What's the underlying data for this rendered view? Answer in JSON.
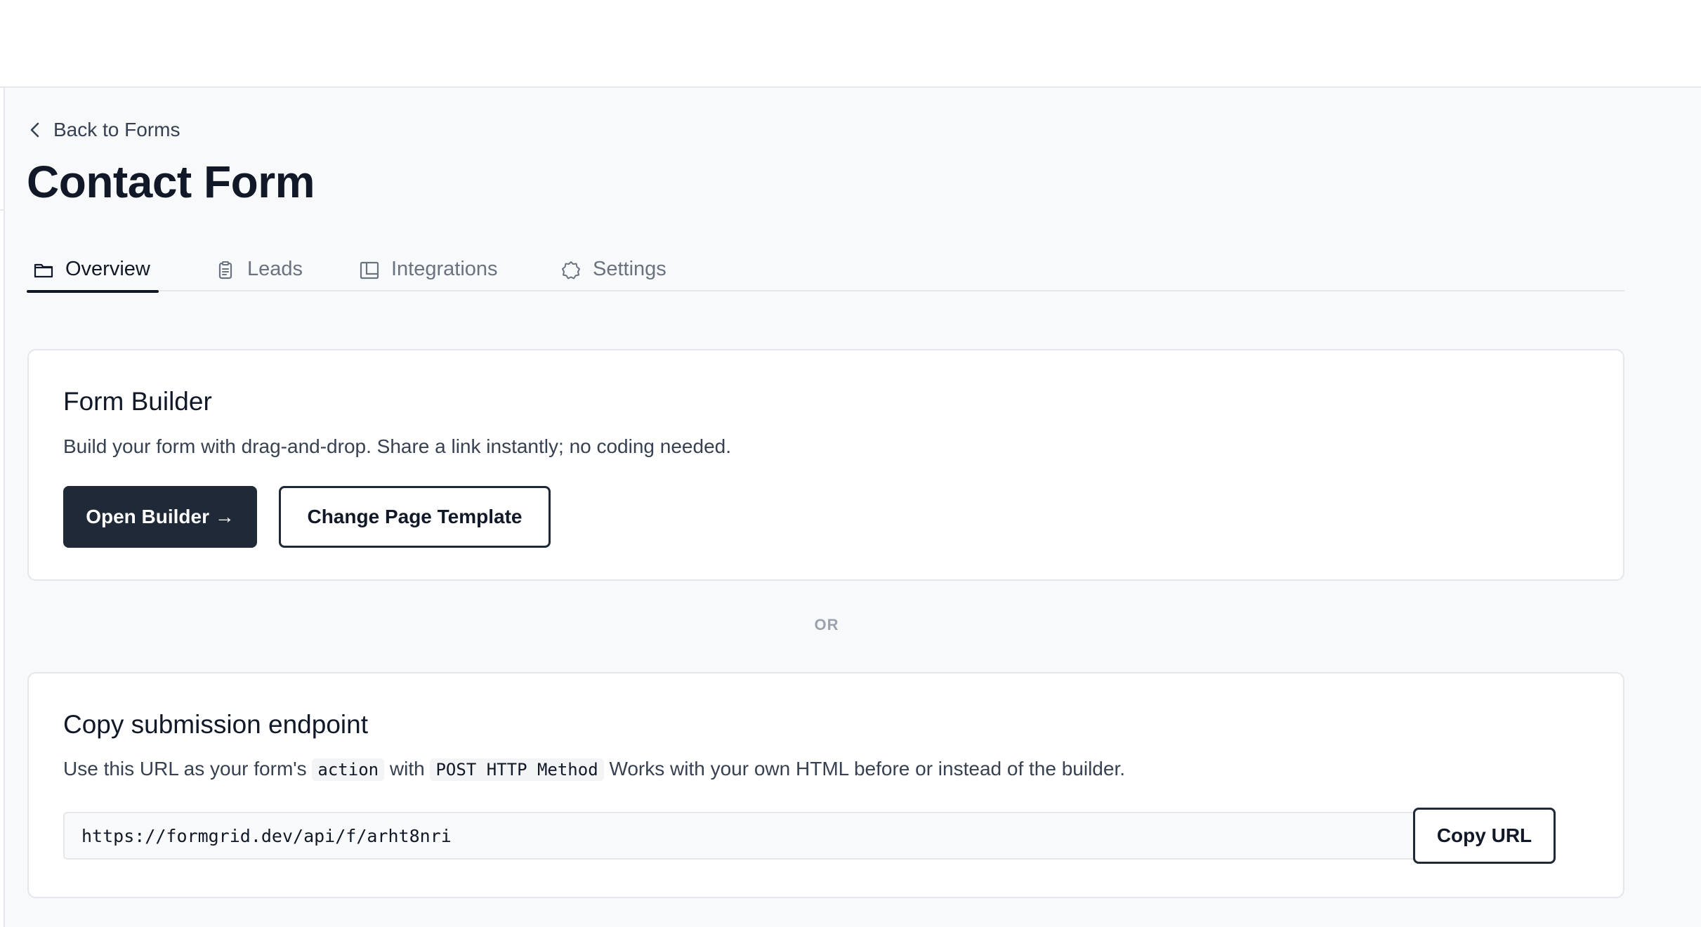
{
  "back_link": {
    "label": "Back to Forms"
  },
  "page": {
    "title": "Contact Form"
  },
  "tabs": [
    {
      "label": "Overview",
      "icon": "folder-icon",
      "active": true
    },
    {
      "label": "Leads",
      "icon": "clipboard-icon",
      "active": false
    },
    {
      "label": "Integrations",
      "icon": "layout-icon",
      "active": false
    },
    {
      "label": "Settings",
      "icon": "gear-icon",
      "active": false
    }
  ],
  "form_builder": {
    "title": "Form Builder",
    "description": "Build your form with drag-and-drop. Share a link instantly; no coding needed.",
    "open_button": "Open Builder →",
    "template_button": "Change Page Template"
  },
  "divider": {
    "label": "OR"
  },
  "endpoint": {
    "title": "Copy submission endpoint",
    "desc_part1": "Use this URL as your form's",
    "code_action": "action",
    "desc_part2": "with",
    "code_method": "POST HTTP Method",
    "desc_part3": "Works with your own HTML before or instead of the builder.",
    "url": "https://formgrid.dev/api/f/arht8nri",
    "copy_button": "Copy URL"
  },
  "colors": {
    "accent_dark": "#1f2937",
    "page_bg": "#f8f9fb",
    "border": "#e5e7eb",
    "muted_text": "#6b7280"
  }
}
